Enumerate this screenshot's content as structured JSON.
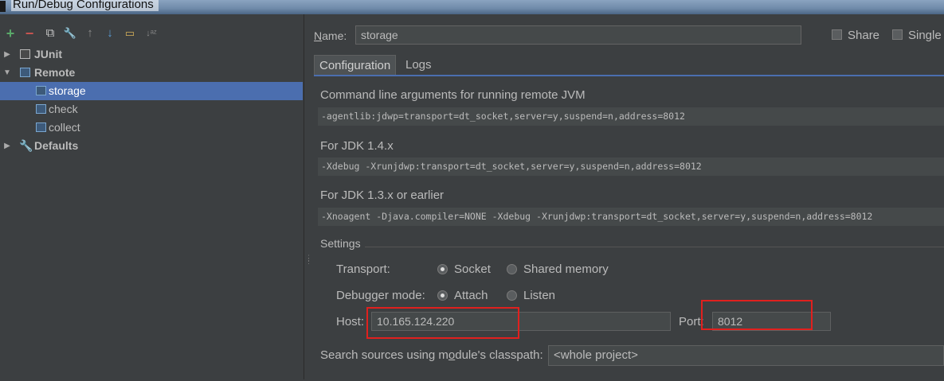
{
  "window": {
    "title": "Run/Debug Configurations"
  },
  "toolbar": {
    "add": "+",
    "remove": "−",
    "copy": "⧉",
    "edit_defaults": "🔧",
    "move_up": "↑",
    "move_down": "↓",
    "folder": "▭",
    "sort": "↓ᵃᶻ",
    "colors": {
      "add": "#59a869",
      "remove": "#c75450",
      "arrows": "#5a9bd5"
    }
  },
  "tree": {
    "junit": "JUnit",
    "remote": "Remote",
    "children": [
      "storage",
      "check",
      "collect"
    ],
    "defaults": "Defaults",
    "selected": "storage"
  },
  "form": {
    "name_label_prefix": "N",
    "name_label_rest": "ame:",
    "name_value": "storage",
    "share_label": "Share",
    "single_label": "Single",
    "tabs": [
      "Configuration",
      "Logs"
    ],
    "cmd_label": "Command line arguments for running remote JVM",
    "cmd_value": "-agentlib:jdwp=transport=dt_socket,server=y,suspend=n,address=8012",
    "jdk14_label": "For JDK 1.4.x",
    "jdk14_value": "-Xdebug -Xrunjdwp:transport=dt_socket,server=y,suspend=n,address=8012",
    "jdk13_label": "For JDK 1.3.x or earlier",
    "jdk13_value": "-Xnoagent -Djava.compiler=NONE -Xdebug -Xrunjdwp:transport=dt_socket,server=y,suspend=n,address=8012",
    "settings_label": "Settings",
    "transport_label": "Transport:",
    "transport_options": [
      "Socket",
      "Shared memory"
    ],
    "transport_selected": "Socket",
    "debugger_label": "Debugger mode:",
    "debugger_options": [
      "Attach",
      "Listen"
    ],
    "debugger_selected": "Attach",
    "host_label": "Host:",
    "host_value": "10.165.124.220",
    "port_label": "Port:",
    "port_value": "8012",
    "classpath_label_a": "Search sources using m",
    "classpath_label_u": "o",
    "classpath_label_b": "dule's classpath:",
    "classpath_value": "<whole project>"
  },
  "colors": {
    "selection": "#4b6eaf",
    "highlight_box": "#e0201e"
  }
}
